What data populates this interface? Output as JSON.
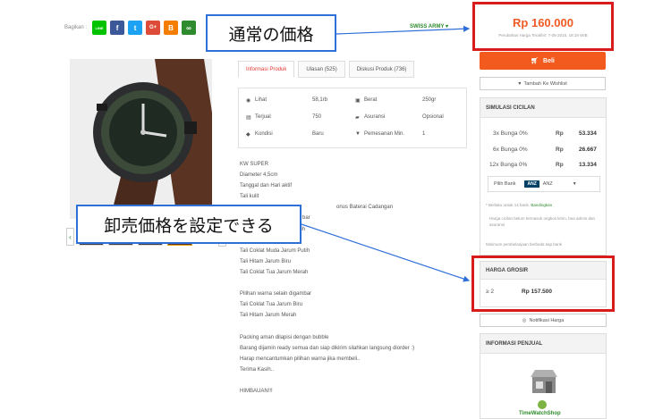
{
  "share": {
    "label": "Bagikan :",
    "buttons": [
      {
        "name": "line",
        "text": "LINE",
        "color": "#00c300"
      },
      {
        "name": "facebook",
        "text": "f",
        "color": "#3b5998"
      },
      {
        "name": "twitter",
        "text": "t",
        "color": "#1da1f2"
      },
      {
        "name": "google-plus",
        "text": "G+",
        "color": "#dd4b39"
      },
      {
        "name": "blogger",
        "text": "B",
        "color": "#f57d00"
      },
      {
        "name": "link",
        "text": "∞",
        "color": "#2e8b2e"
      }
    ]
  },
  "brand": {
    "label": "SWISS ARMY ▾"
  },
  "callouts": {
    "price": "通常の価格",
    "grosir": "卸売価格を設定できる"
  },
  "price": {
    "amount": "Rp 160.000",
    "note": "Perubahan Harga Terakhir: 7-08-2016, 18:19 WIB"
  },
  "tabs": [
    {
      "label": "Informasi Produk",
      "active": true
    },
    {
      "label": "Ulasan (525)",
      "active": false
    },
    {
      "label": "Diskusi Produk (736)",
      "active": false
    }
  ],
  "info": {
    "rows": [
      {
        "k1": "Lihat",
        "v1": "58,1rb",
        "k2": "Berat",
        "v2": "250gr"
      },
      {
        "k1": "Terjual",
        "v1": "750",
        "k2": "Asuransi",
        "v2": "Opsional"
      },
      {
        "k1": "Kondisi",
        "v1": "Baru",
        "k2": "Pemesanan Min.",
        "v2": "1"
      }
    ]
  },
  "description": [
    "KW SUPER",
    "Diameter 4,5cm",
    "Tanggal dan Hari aktif",
    "Tali kulit",
    "onus Baterai Cadangan",
    "bar",
    "Tali Coklat Tua Jarum Putih",
    "Tali Hitam Jarum Putih",
    "Tali Coklat Muda Jarum Putih",
    "Tali Hitam Jarum Biru",
    "Tali Coklat Tua Jarum Merah",
    "",
    "Pilihan warna selain digambar",
    "Tali Coklat Tua Jarum Biru",
    "Tali Hitam Jarum Merah",
    "",
    "Packing aman dilapisi dengan bubble",
    "Barang dijamin ready semua dan siap dikirim silahkan langsung diorder :)",
    "Harap mencantumkan pilihan warna jika membeli..",
    "Terima Kasih..",
    "",
    "HIMBAUAN!!!"
  ],
  "buy": {
    "label": "Beli",
    "wishlist": "Tambah Ke Wishlist"
  },
  "simulation": {
    "title": "SIMULASI CICILAN",
    "rows": [
      {
        "term": "3x Bunga 0%",
        "cur": "Rp",
        "amount": "53.334"
      },
      {
        "term": "6x Bunga 0%",
        "cur": "Rp",
        "amount": "26.667"
      },
      {
        "term": "12x Bunga 0%",
        "cur": "Rp",
        "amount": "13.334"
      }
    ],
    "bank_label": "Pilih Bank",
    "bank_logo": "ANZ",
    "bank_value": "ANZ",
    "note1": "Berlaku untuk 14 bank.",
    "note1_link": "Bandingkan",
    "note2": "Harga cicilan belum termasuk ongkos kirim, bea admin dan asuransi",
    "note3": "Minimum pembelanjaan berbeda tiap bank"
  },
  "grosir": {
    "title": "HARGA GROSIR",
    "qty": "≥ 2",
    "price": "Rp 157.500"
  },
  "notify": {
    "label": "Notifikasi Harga"
  },
  "seller": {
    "title": "INFORMASI PENJUAL",
    "name": "TimeWatchShop"
  },
  "colors": {
    "accent": "#f25a1e",
    "highlight": "#d81b1b",
    "callout": "#2f6fd8"
  }
}
